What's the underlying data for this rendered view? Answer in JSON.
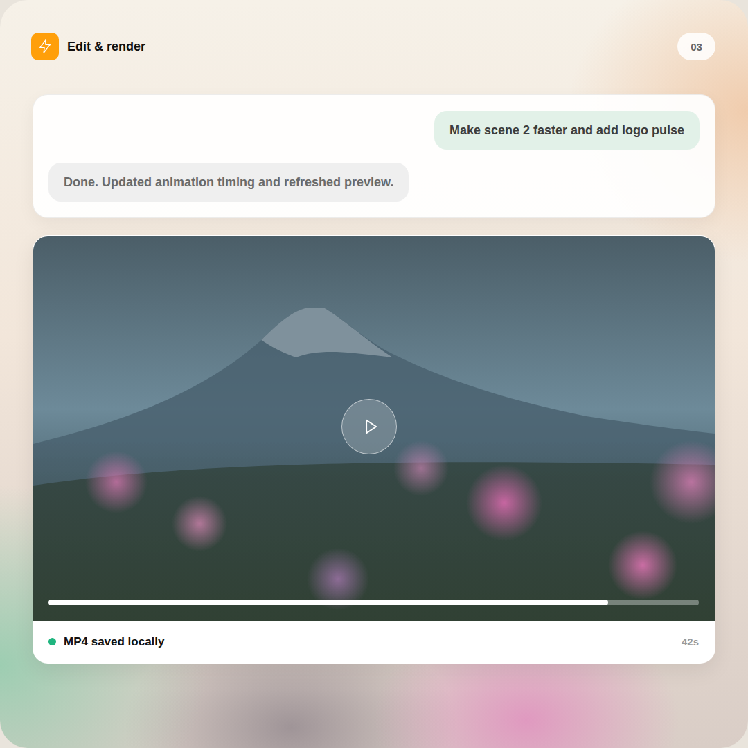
{
  "header": {
    "title": "Edit & render",
    "step": "03"
  },
  "messages": [
    {
      "kind": "user",
      "text": "Make scene 2 faster and add logo pulse"
    },
    {
      "kind": "assistant",
      "text": "Done. Updated animation timing and refreshed preview."
    }
  ],
  "video": {
    "playing": false,
    "progress": {
      "level": 0.86
    }
  },
  "status": {
    "text": "MP4 saved locally",
    "duration": "42s"
  }
}
